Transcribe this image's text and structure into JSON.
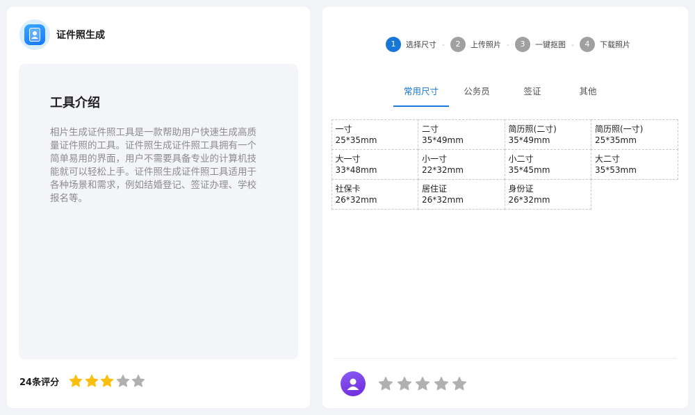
{
  "app": {
    "title": "证件照生成"
  },
  "intro": {
    "heading": "工具介绍",
    "body": "相片生成证件照工具是一款帮助用户快速生成高质量证件照的工具。证件照生成证件照工具拥有一个简单易用的界面，用户不需要具备专业的计算机技能就可以轻松上手。证件照生成证件照工具适用于各种场景和需求，例如结婚登记、签证办理、学校报名等。"
  },
  "rating": {
    "count_label": "24条评分",
    "stars_filled": 3,
    "stars_total": 5
  },
  "steps": [
    {
      "num": "1",
      "label": "选择尺寸",
      "active": true
    },
    {
      "num": "2",
      "label": "上传照片",
      "active": false
    },
    {
      "num": "3",
      "label": "一键抠图",
      "active": false
    },
    {
      "num": "4",
      "label": "下载照片",
      "active": false
    }
  ],
  "step_separator": "-",
  "tabs": [
    {
      "label": "常用尺寸",
      "active": true
    },
    {
      "label": "公务员",
      "active": false
    },
    {
      "label": "签证",
      "active": false
    },
    {
      "label": "其他",
      "active": false
    }
  ],
  "sizes": [
    {
      "name": "一寸",
      "dim": "25*35mm"
    },
    {
      "name": "二寸",
      "dim": "35*49mm"
    },
    {
      "name": "简历照(二寸)",
      "dim": "35*49mm"
    },
    {
      "name": "简历照(一寸)",
      "dim": "25*35mm"
    },
    {
      "name": "大一寸",
      "dim": "33*48mm"
    },
    {
      "name": "小一寸",
      "dim": "22*32mm"
    },
    {
      "name": "小二寸",
      "dim": "35*45mm"
    },
    {
      "name": "大二寸",
      "dim": "35*53mm"
    },
    {
      "name": "社保卡",
      "dim": "26*32mm"
    },
    {
      "name": "居住证",
      "dim": "26*32mm"
    },
    {
      "name": "身份证",
      "dim": "26*32mm"
    }
  ],
  "user_rating": {
    "stars_filled": 0,
    "stars_total": 5
  },
  "colors": {
    "accent": "#1677d9",
    "star_filled": "#fbbf0f",
    "star_empty": "#b0b0b0",
    "avatar": "#7c3aed"
  },
  "icons": {
    "logo": "id-card-icon",
    "avatar": "user-icon",
    "star": "star-icon"
  }
}
